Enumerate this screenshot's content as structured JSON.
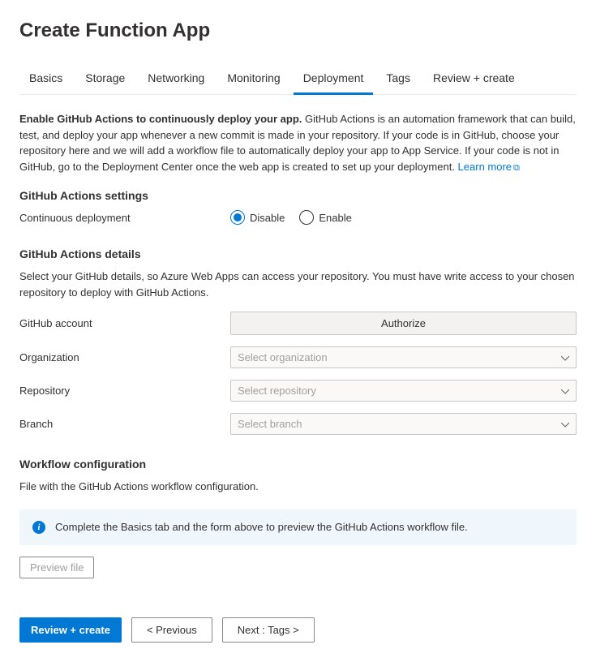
{
  "page_title": "Create Function App",
  "tabs": {
    "basics": "Basics",
    "storage": "Storage",
    "networking": "Networking",
    "monitoring": "Monitoring",
    "deployment": "Deployment",
    "tags": "Tags",
    "review": "Review + create"
  },
  "active_tab": "deployment",
  "intro_bold": "Enable GitHub Actions to continuously deploy your app.",
  "intro_rest": " GitHub Actions is an automation framework that can build, test, and deploy your app whenever a new commit is made in your repository. If your code is in GitHub, choose your repository here and we will add a workflow file to automatically deploy your app to App Service. If your code is not in GitHub, go to the Deployment Center once the web app is created to set up your deployment. ",
  "learn_more": "Learn more",
  "section_settings": {
    "title": "GitHub Actions settings",
    "cd_label": "Continuous deployment",
    "disable": "Disable",
    "enable": "Enable",
    "selected": "disable"
  },
  "section_details": {
    "title": "GitHub Actions details",
    "desc": "Select your GitHub details, so Azure Web Apps can access your repository. You must have write access to your chosen repository to deploy with GitHub Actions.",
    "account_label": "GitHub account",
    "authorize": "Authorize",
    "org_label": "Organization",
    "org_placeholder": "Select organization",
    "repo_label": "Repository",
    "repo_placeholder": "Select repository",
    "branch_label": "Branch",
    "branch_placeholder": "Select branch"
  },
  "section_workflow": {
    "title": "Workflow configuration",
    "desc": "File with the GitHub Actions workflow configuration.",
    "info": "Complete the Basics tab and the form above to preview the GitHub Actions workflow file.",
    "preview": "Preview file"
  },
  "footer": {
    "review": "Review + create",
    "prev": "< Previous",
    "next": "Next : Tags >"
  }
}
